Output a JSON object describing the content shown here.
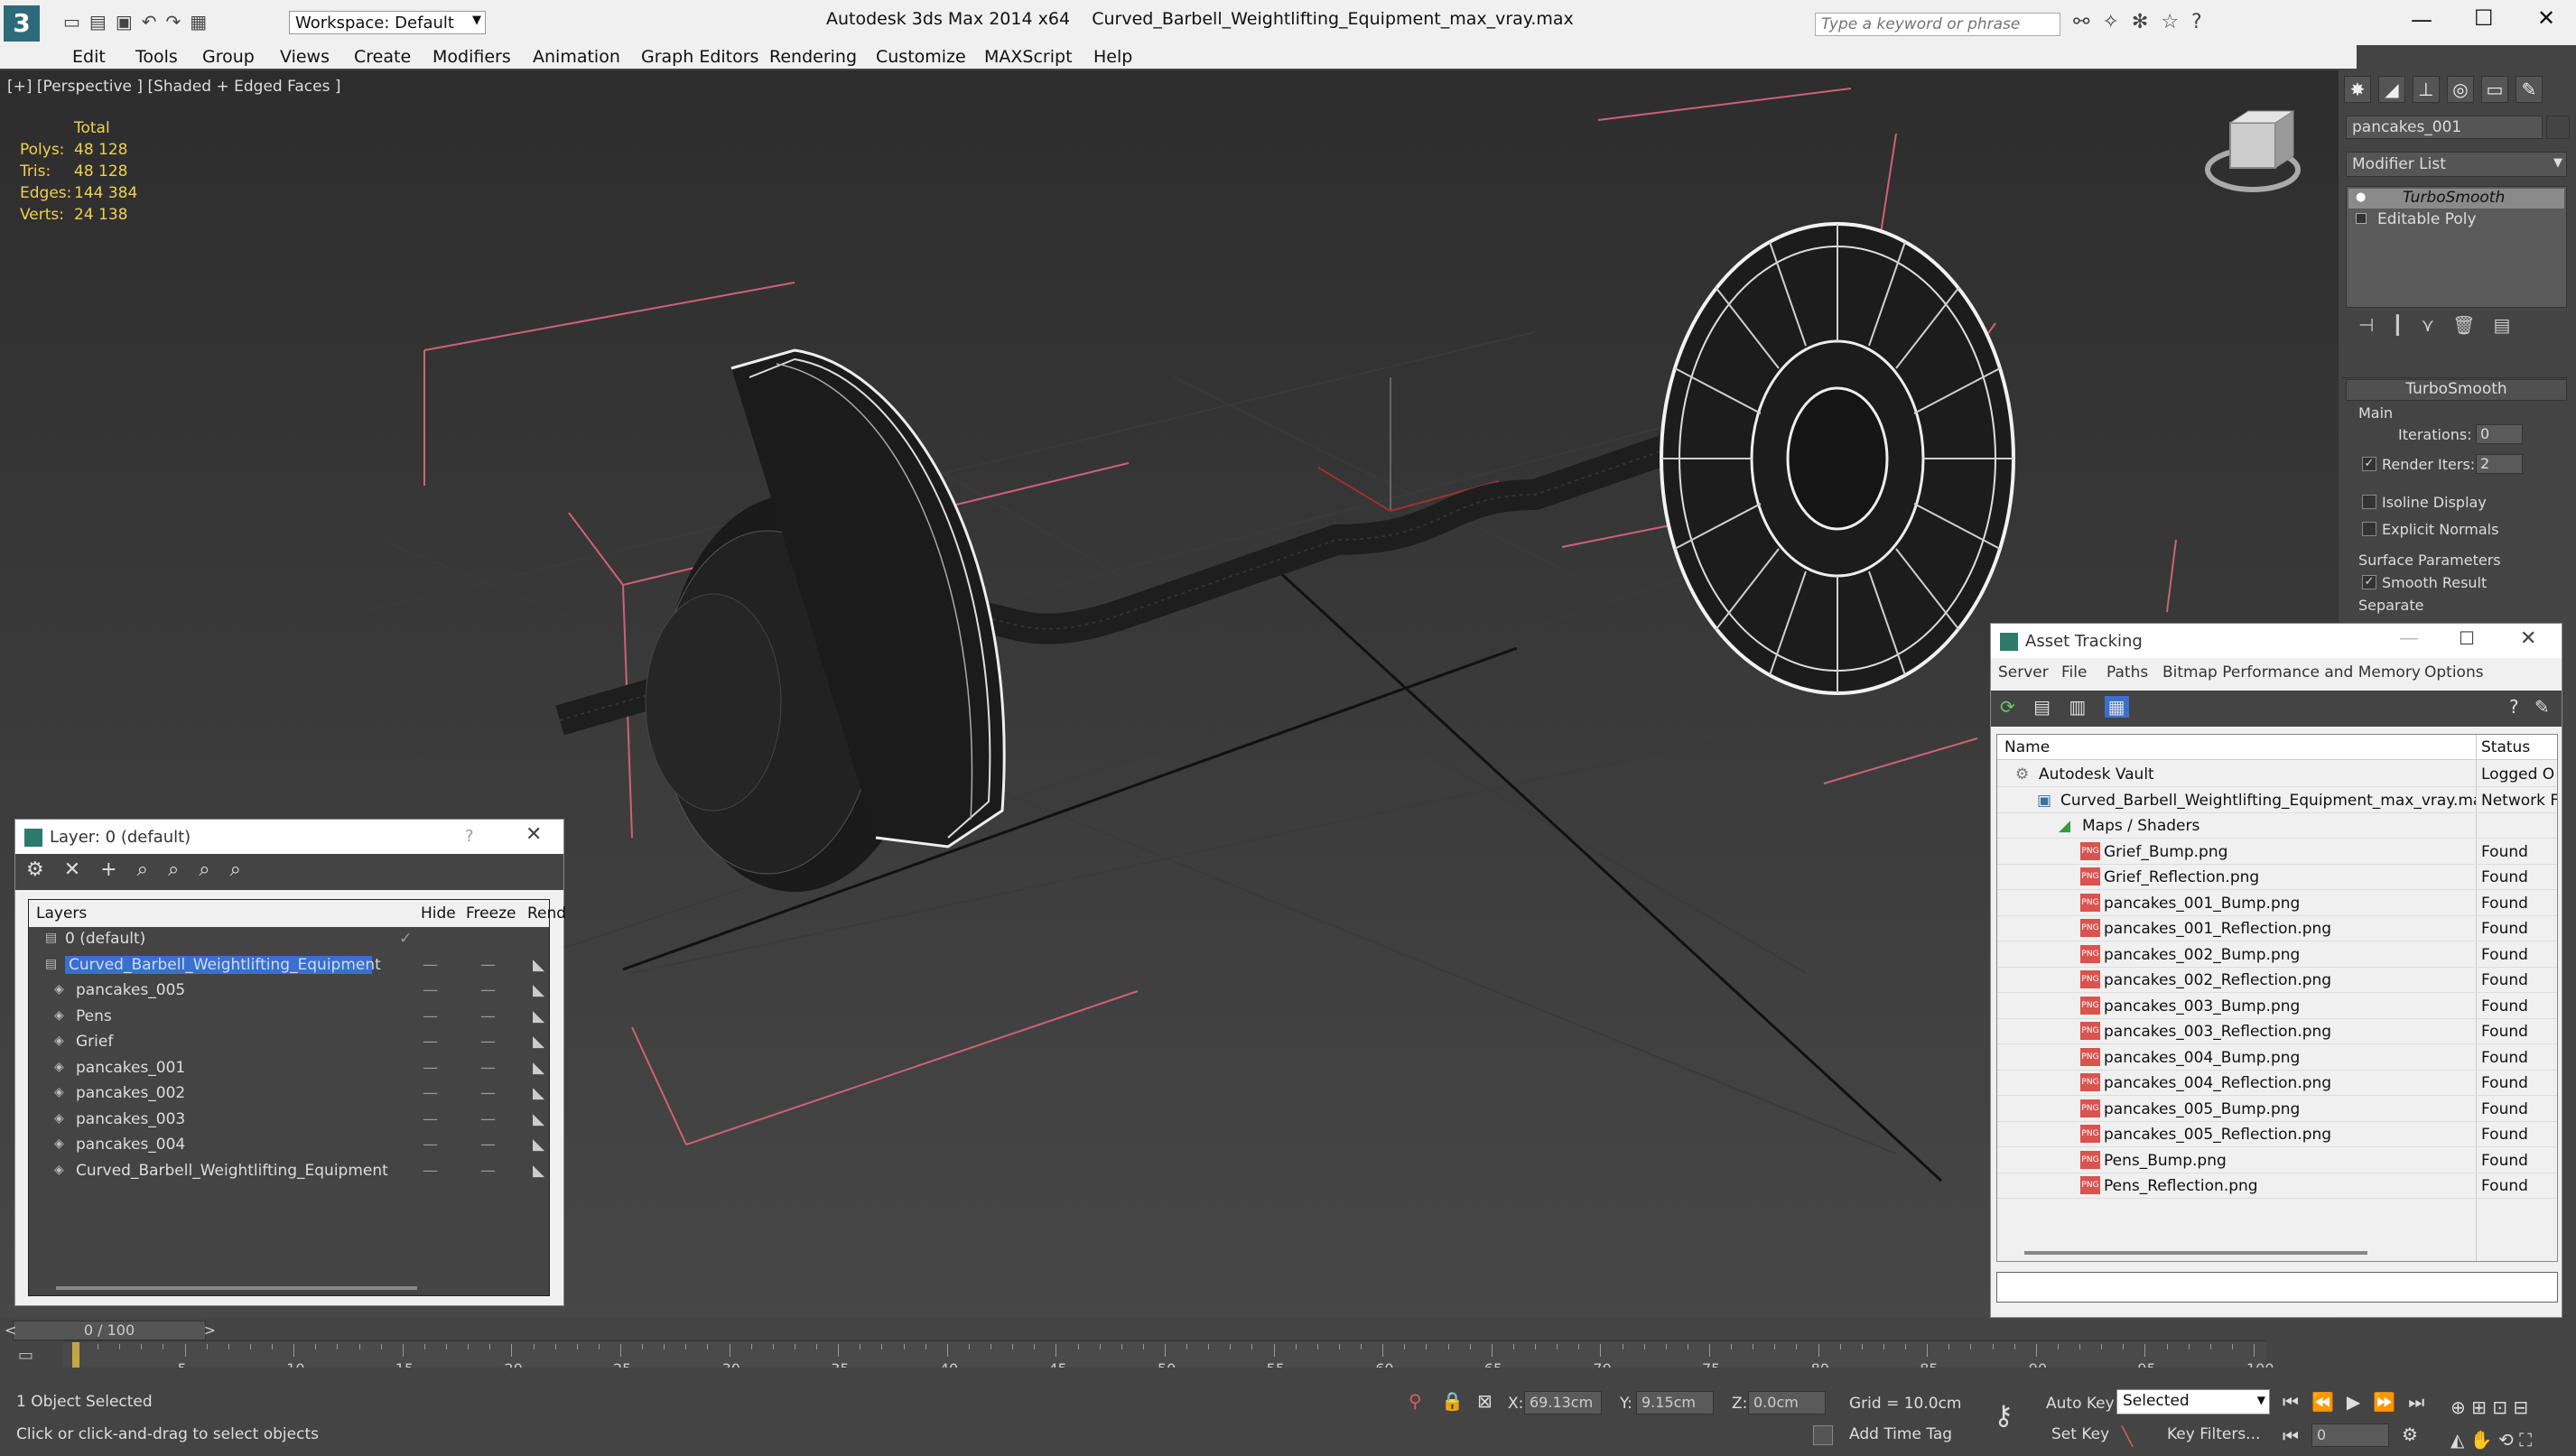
{
  "title": {
    "workspace": "Workspace: Default",
    "app": "Autodesk 3ds Max  2014 x64",
    "file": "Curved_Barbell_Weightlifting_Equipment_max_vray.max",
    "search_placeholder": "Type a keyword or phrase"
  },
  "menu": [
    "Edit",
    "Tools",
    "Group",
    "Views",
    "Create",
    "Modifiers",
    "Animation",
    "Graph Editors",
    "Rendering",
    "Customize",
    "MAXScript",
    "Help"
  ],
  "viewport": {
    "label": "[+] [Perspective ] [Shaded + Edged Faces ]",
    "stats": {
      "header": "Total",
      "rows": [
        {
          "label": "Polys:",
          "value": "48 128"
        },
        {
          "label": "Tris:",
          "value": "48 128"
        },
        {
          "label": "Edges:",
          "value": "144 384"
        },
        {
          "label": "Verts:",
          "value": "24 138"
        }
      ]
    }
  },
  "command_panel": {
    "object_name": "pancakes_001",
    "modifier_list": "Modifier List",
    "stack": [
      "TurboSmooth",
      "Editable Poly"
    ],
    "rollout_title": "TurboSmooth",
    "main": "Main",
    "iterations_label": "Iterations:",
    "iterations_value": "0",
    "render_iters_label": "Render Iters:",
    "render_iters_value": "2",
    "isoline": "Isoline Display",
    "explicit": "Explicit Normals",
    "surface_params": "Surface Parameters",
    "smooth_result": "Smooth Result",
    "separate": "Separate"
  },
  "layer_window": {
    "title": "Layer: 0 (default)",
    "help": "?",
    "columns": [
      "Layers",
      "Hide",
      "Freeze",
      "Rend"
    ],
    "rows": [
      {
        "name": "0 (default)",
        "level": 0
      },
      {
        "name": "Curved_Barbell_Weightlifting_Equipment",
        "level": 0
      },
      {
        "name": "pancakes_005",
        "level": 1
      },
      {
        "name": "Pens",
        "level": 1
      },
      {
        "name": "Grief",
        "level": 1
      },
      {
        "name": "pancakes_001",
        "level": 1
      },
      {
        "name": "pancakes_002",
        "level": 1
      },
      {
        "name": "pancakes_003",
        "level": 1
      },
      {
        "name": "pancakes_004",
        "level": 1
      },
      {
        "name": "Curved_Barbell_Weightlifting_Equipment",
        "level": 1
      }
    ]
  },
  "asset_window": {
    "title": "Asset Tracking",
    "menu": [
      "Server",
      "File",
      "Paths",
      "Bitmap Performance and Memory",
      "Options"
    ],
    "columns": [
      "Name",
      "Status"
    ],
    "rows": [
      {
        "name": "Autodesk Vault",
        "status": "Logged O",
        "level": 0,
        "icon": "vault-icon"
      },
      {
        "name": "Curved_Barbell_Weightlifting_Equipment_max_vray.max",
        "status": "Network F",
        "level": 1,
        "icon": "max-file-icon"
      },
      {
        "name": "Maps / Shaders",
        "status": "",
        "level": 2,
        "icon": "maps-icon"
      },
      {
        "name": "Grief_Bump.png",
        "status": "Found",
        "level": 3,
        "icon": "png-icon"
      },
      {
        "name": "Grief_Reflection.png",
        "status": "Found",
        "level": 3,
        "icon": "png-icon"
      },
      {
        "name": "pancakes_001_Bump.png",
        "status": "Found",
        "level": 3,
        "icon": "png-icon"
      },
      {
        "name": "pancakes_001_Reflection.png",
        "status": "Found",
        "level": 3,
        "icon": "png-icon"
      },
      {
        "name": "pancakes_002_Bump.png",
        "status": "Found",
        "level": 3,
        "icon": "png-icon"
      },
      {
        "name": "pancakes_002_Reflection.png",
        "status": "Found",
        "level": 3,
        "icon": "png-icon"
      },
      {
        "name": "pancakes_003_Bump.png",
        "status": "Found",
        "level": 3,
        "icon": "png-icon"
      },
      {
        "name": "pancakes_003_Reflection.png",
        "status": "Found",
        "level": 3,
        "icon": "png-icon"
      },
      {
        "name": "pancakes_004_Bump.png",
        "status": "Found",
        "level": 3,
        "icon": "png-icon"
      },
      {
        "name": "pancakes_004_Reflection.png",
        "status": "Found",
        "level": 3,
        "icon": "png-icon"
      },
      {
        "name": "pancakes_005_Bump.png",
        "status": "Found",
        "level": 3,
        "icon": "png-icon"
      },
      {
        "name": "pancakes_005_Reflection.png",
        "status": "Found",
        "level": 3,
        "icon": "png-icon"
      },
      {
        "name": "Pens_Bump.png",
        "status": "Found",
        "level": 3,
        "icon": "png-icon"
      },
      {
        "name": "Pens_Reflection.png",
        "status": "Found",
        "level": 3,
        "icon": "png-icon"
      }
    ]
  },
  "timeline": {
    "frame": "0 / 100",
    "ticks": [
      "5",
      "10",
      "15",
      "20",
      "25",
      "30",
      "35",
      "40",
      "45",
      "50",
      "55",
      "60",
      "65",
      "70",
      "75",
      "80",
      "85",
      "90",
      "95",
      "100"
    ],
    "start": 0,
    "end": 100
  },
  "status": {
    "selected": "1 Object Selected",
    "prompt": "Click or click-and-drag to select objects",
    "x_label": "X:",
    "x": "69.13cm",
    "y_label": "Y:",
    "y": "9.15cm",
    "z_label": "Z:",
    "z": "0.0cm",
    "grid": "Grid = 10.0cm",
    "add_time_tag": "Add Time Tag",
    "auto_key": "Auto Key",
    "set_key": "Set Key",
    "selected_dropdown": "Selected",
    "key_filters": "Key Filters...",
    "frame_field": "0"
  }
}
